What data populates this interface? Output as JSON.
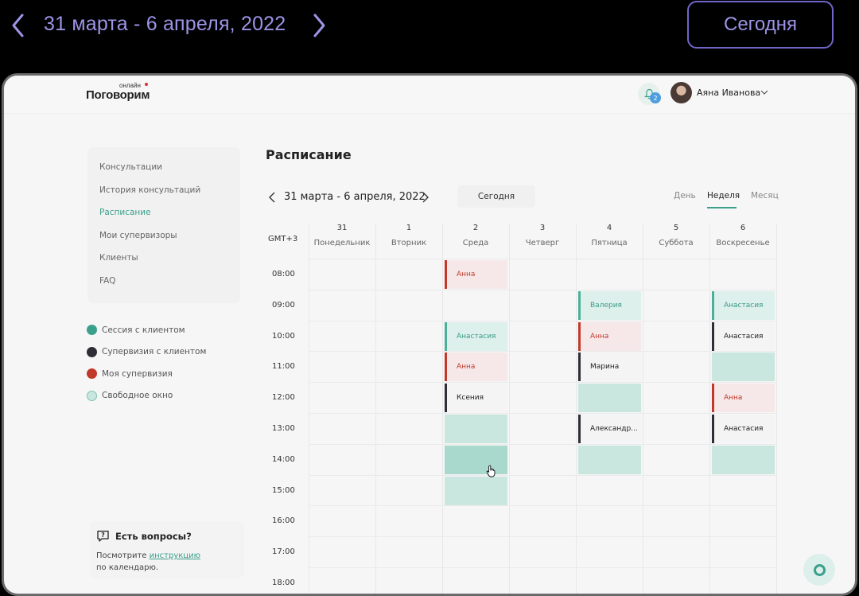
{
  "outer": {
    "date_range": "31 марта - 6 апреля, 2022",
    "today_label": "Сегодня",
    "accent": "#9C94E6"
  },
  "header": {
    "logo_main": "Поговорим",
    "logo_sup": "онлайн",
    "notifications_count": "2",
    "user_name": "Аяна Иванова"
  },
  "sidebar": {
    "items": [
      {
        "label": "Консультации"
      },
      {
        "label": "История консультаций"
      },
      {
        "label": "Расписание"
      },
      {
        "label": "Мои супервизоры"
      },
      {
        "label": "Клиенты"
      },
      {
        "label": "FAQ"
      }
    ],
    "active_index": 2
  },
  "legend": [
    {
      "label": "Сессия с клиентом",
      "color": "#3AA08C"
    },
    {
      "label": "Супервизия с клиентом",
      "color": "#2E2E36"
    },
    {
      "label": "Моя супервизия",
      "color": "#C0392B"
    },
    {
      "label": "Свободное окно",
      "color": "#C9E6DF"
    }
  ],
  "help": {
    "title": "Есть вопросы?",
    "text_before": "Посмотрите ",
    "link": "инструкцию",
    "text_after": "по календарю."
  },
  "page": {
    "title": "Расписание",
    "date_range": "31 марта - 6 апреля, 2022",
    "today_label": "Сегодня",
    "views": [
      "День",
      "Неделя",
      "Месяц"
    ],
    "active_view": "Неделя"
  },
  "calendar": {
    "timezone": "GMT+3",
    "days": [
      {
        "num": "31",
        "name": "Понедельник"
      },
      {
        "num": "1",
        "name": "Вторник"
      },
      {
        "num": "2",
        "name": "Среда"
      },
      {
        "num": "3",
        "name": "Четверг"
      },
      {
        "num": "4",
        "name": "Пятница"
      },
      {
        "num": "5",
        "name": "Суббота"
      },
      {
        "num": "6",
        "name": "Воскресенье"
      }
    ],
    "hours": [
      "08:00",
      "09:00",
      "10:00",
      "11:00",
      "12:00",
      "13:00",
      "14:00",
      "15:00",
      "16:00",
      "17:00",
      "18:00"
    ],
    "events": [
      {
        "day": 2,
        "hour": 0,
        "kind": "red",
        "label": "Анна"
      },
      {
        "day": 2,
        "hour": 2,
        "kind": "teal",
        "label": "Анастасия"
      },
      {
        "day": 2,
        "hour": 3,
        "kind": "red",
        "label": "Анна"
      },
      {
        "day": 2,
        "hour": 4,
        "kind": "dark",
        "label": "Ксения"
      },
      {
        "day": 2,
        "hour": 5,
        "kind": "free",
        "label": ""
      },
      {
        "day": 2,
        "hour": 6,
        "kind": "free-hover",
        "label": ""
      },
      {
        "day": 2,
        "hour": 7,
        "kind": "free",
        "label": ""
      },
      {
        "day": 4,
        "hour": 1,
        "kind": "teal",
        "label": "Валерия"
      },
      {
        "day": 4,
        "hour": 2,
        "kind": "red",
        "label": "Анна"
      },
      {
        "day": 4,
        "hour": 3,
        "kind": "dark",
        "label": "Марина"
      },
      {
        "day": 4,
        "hour": 4,
        "kind": "free",
        "label": ""
      },
      {
        "day": 4,
        "hour": 5,
        "kind": "dark",
        "label": "Александр..."
      },
      {
        "day": 4,
        "hour": 6,
        "kind": "free",
        "label": ""
      },
      {
        "day": 6,
        "hour": 1,
        "kind": "teal",
        "label": "Анастасия"
      },
      {
        "day": 6,
        "hour": 2,
        "kind": "dark",
        "label": "Анастасия"
      },
      {
        "day": 6,
        "hour": 3,
        "kind": "free",
        "label": ""
      },
      {
        "day": 6,
        "hour": 4,
        "kind": "red",
        "label": "Анна"
      },
      {
        "day": 6,
        "hour": 5,
        "kind": "dark",
        "label": "Анастасия"
      },
      {
        "day": 6,
        "hour": 6,
        "kind": "free",
        "label": ""
      }
    ]
  }
}
